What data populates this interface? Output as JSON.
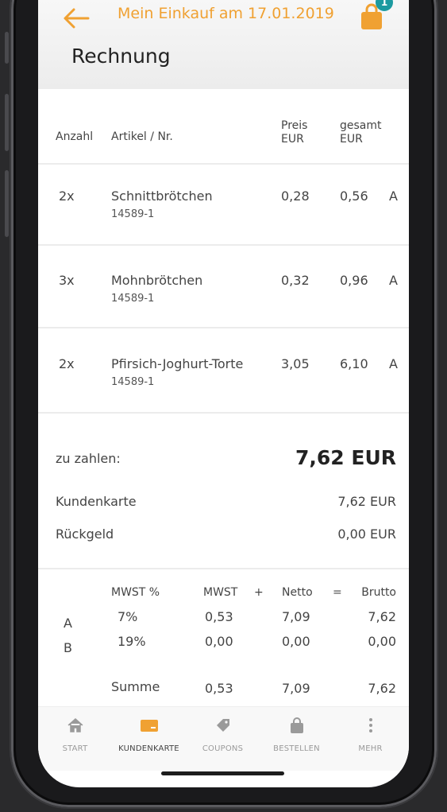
{
  "header": {
    "title": "Mein Einkauf am 17.01.2019",
    "cart_badge": "1",
    "page_title": "Rechnung",
    "accent_color": "#f0a132"
  },
  "table": {
    "headers": {
      "qty": "Anzahl",
      "article": "Artikel / Nr.",
      "price_1": "Preis",
      "price_2": "EUR",
      "total_1": "gesamt",
      "total_2": "EUR"
    },
    "rows": [
      {
        "qty": "2x",
        "name": "Schnittbrötchen",
        "nr": "14589-1",
        "price": "0,28",
        "total": "0,56",
        "tax": "A"
      },
      {
        "qty": "3x",
        "name": "Mohnbrötchen",
        "nr": "14589-1",
        "price": "0,32",
        "total": "0,96",
        "tax": "A"
      },
      {
        "qty": "2x",
        "name": "Pfirsich-Joghurt-Torte",
        "nr": "14589-1",
        "price": "3,05",
        "total": "6,10",
        "tax": "A"
      }
    ]
  },
  "summary": {
    "to_pay_label": "zu zahlen:",
    "to_pay_value": "7,62 EUR",
    "card_label": "Kundenkarte",
    "card_value": "7,62 EUR",
    "change_label": "Rückgeld",
    "change_value": "0,00 EUR"
  },
  "tax": {
    "headers": {
      "rate": "MWST %",
      "amount": "MWST",
      "plus": "+",
      "net": "Netto",
      "eq": "=",
      "gross": "Brutto"
    },
    "rows": [
      {
        "code": "A",
        "rate": "7%",
        "amount": "0,53",
        "net": "7,09",
        "gross": "7,62"
      },
      {
        "code": "B",
        "rate": "19%",
        "amount": "0,00",
        "net": "0,00",
        "gross": "0,00"
      }
    ],
    "sum": {
      "label": "Summe",
      "amount": "0,53",
      "net": "7,09",
      "gross": "7,62"
    }
  },
  "nav": {
    "items": [
      {
        "label": "START",
        "icon": "home-icon"
      },
      {
        "label": "KUNDENKARTE",
        "icon": "card-icon"
      },
      {
        "label": "COUPONS",
        "icon": "tag-icon"
      },
      {
        "label": "BESTELLEN",
        "icon": "bag-icon"
      },
      {
        "label": "MEHR",
        "icon": "more-icon"
      }
    ]
  }
}
